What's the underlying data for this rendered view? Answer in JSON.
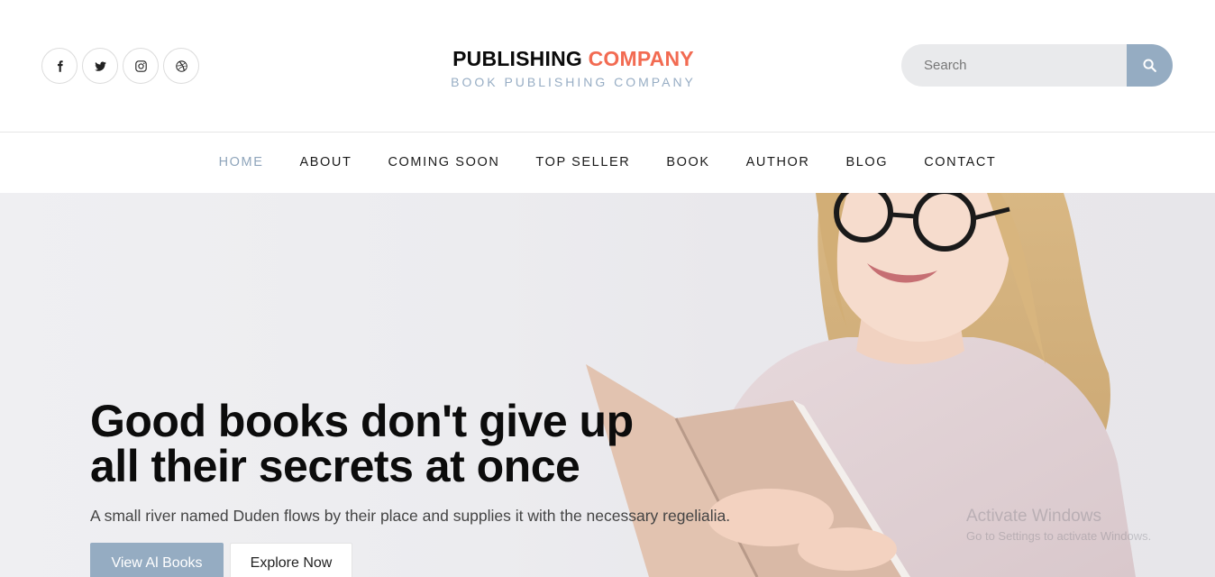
{
  "header": {
    "social_icons": [
      "facebook-icon",
      "twitter-icon",
      "instagram-icon",
      "dribbble-icon"
    ],
    "brand": {
      "name_part1": "PUBLISHING",
      "name_part2": "COMPANY",
      "tagline": "BOOK PUBLISHING COMPANY"
    },
    "search": {
      "placeholder": "Search",
      "icon": "search-icon"
    }
  },
  "nav": {
    "items": [
      {
        "label": "HOME",
        "active": true
      },
      {
        "label": "ABOUT"
      },
      {
        "label": "COMING SOON"
      },
      {
        "label": "TOP SELLER"
      },
      {
        "label": "BOOK"
      },
      {
        "label": "AUTHOR"
      },
      {
        "label": "BLOG"
      },
      {
        "label": "CONTACT"
      }
    ]
  },
  "hero": {
    "title_line1": "Good books don't give up",
    "title_line2": "all their secrets at once",
    "subtitle": "A small river named Duden flows by their place and supplies it with the necessary regelialia.",
    "primary_button": "View Al Books",
    "secondary_button": "Explore Now"
  },
  "watermark": {
    "line1": "Activate Windows",
    "line2": "Go to Settings to activate Windows."
  },
  "colors": {
    "accent": "#95acc2",
    "brand_highlight": "#f26b52",
    "nav_active": "#8fa5bb"
  }
}
